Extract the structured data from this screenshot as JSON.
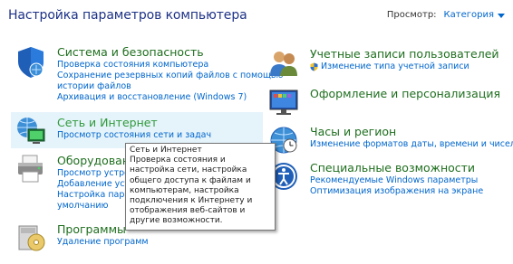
{
  "page": {
    "title": "Настройка параметров компьютера",
    "view_by_label": "Просмотр:",
    "view_by_value": "Категория"
  },
  "left_column": [
    {
      "heading": "Система и безопасность",
      "icon": "shield-icon",
      "links": [
        "Проверка состояния компьютера",
        "Сохранение резервных копий файлов с помощью",
        "истории файлов",
        "Архивация и восстановление (Windows 7)"
      ]
    },
    {
      "heading": "Сеть и Интернет",
      "icon": "network-globe-icon",
      "links": [
        "Просмотр состояния сети и задач"
      ]
    },
    {
      "heading": "Оборудование",
      "icon": "printer-icon",
      "links": [
        "Просмотр устро",
        "Добавление устр",
        "Настройка парам",
        "умолчанию"
      ]
    },
    {
      "heading": "Программы",
      "icon": "programs-disk-icon",
      "links": [
        "Удаление программ"
      ]
    }
  ],
  "right_column": [
    {
      "heading": "Учетные записи пользователей",
      "icon": "users-icon",
      "links": [
        "Изменение типа учетной записи"
      ]
    },
    {
      "heading": "Оформление и персонализация",
      "icon": "monitor-palette-icon",
      "links": []
    },
    {
      "heading": "Часы и регион",
      "icon": "clock-globe-icon",
      "links": [
        "Изменение форматов даты, времени и чисел"
      ]
    },
    {
      "heading": "Специальные возможности",
      "icon": "accessibility-icon",
      "links": [
        "Рекомендуемые Windows параметры",
        "Оптимизация изображения на экране"
      ]
    }
  ],
  "tooltip": {
    "title": "Сеть и Интернет",
    "text": "Проверка состояния и настройка сети, настройка общего доступа к файлам и компьютерам, настройка подключения к Интернету и отображения веб-сайтов и другие возможности."
  },
  "colors": {
    "title": "#1e3287",
    "heading": "#1e6e1e",
    "link": "#0066cc",
    "hover": "#e5f3fb"
  }
}
